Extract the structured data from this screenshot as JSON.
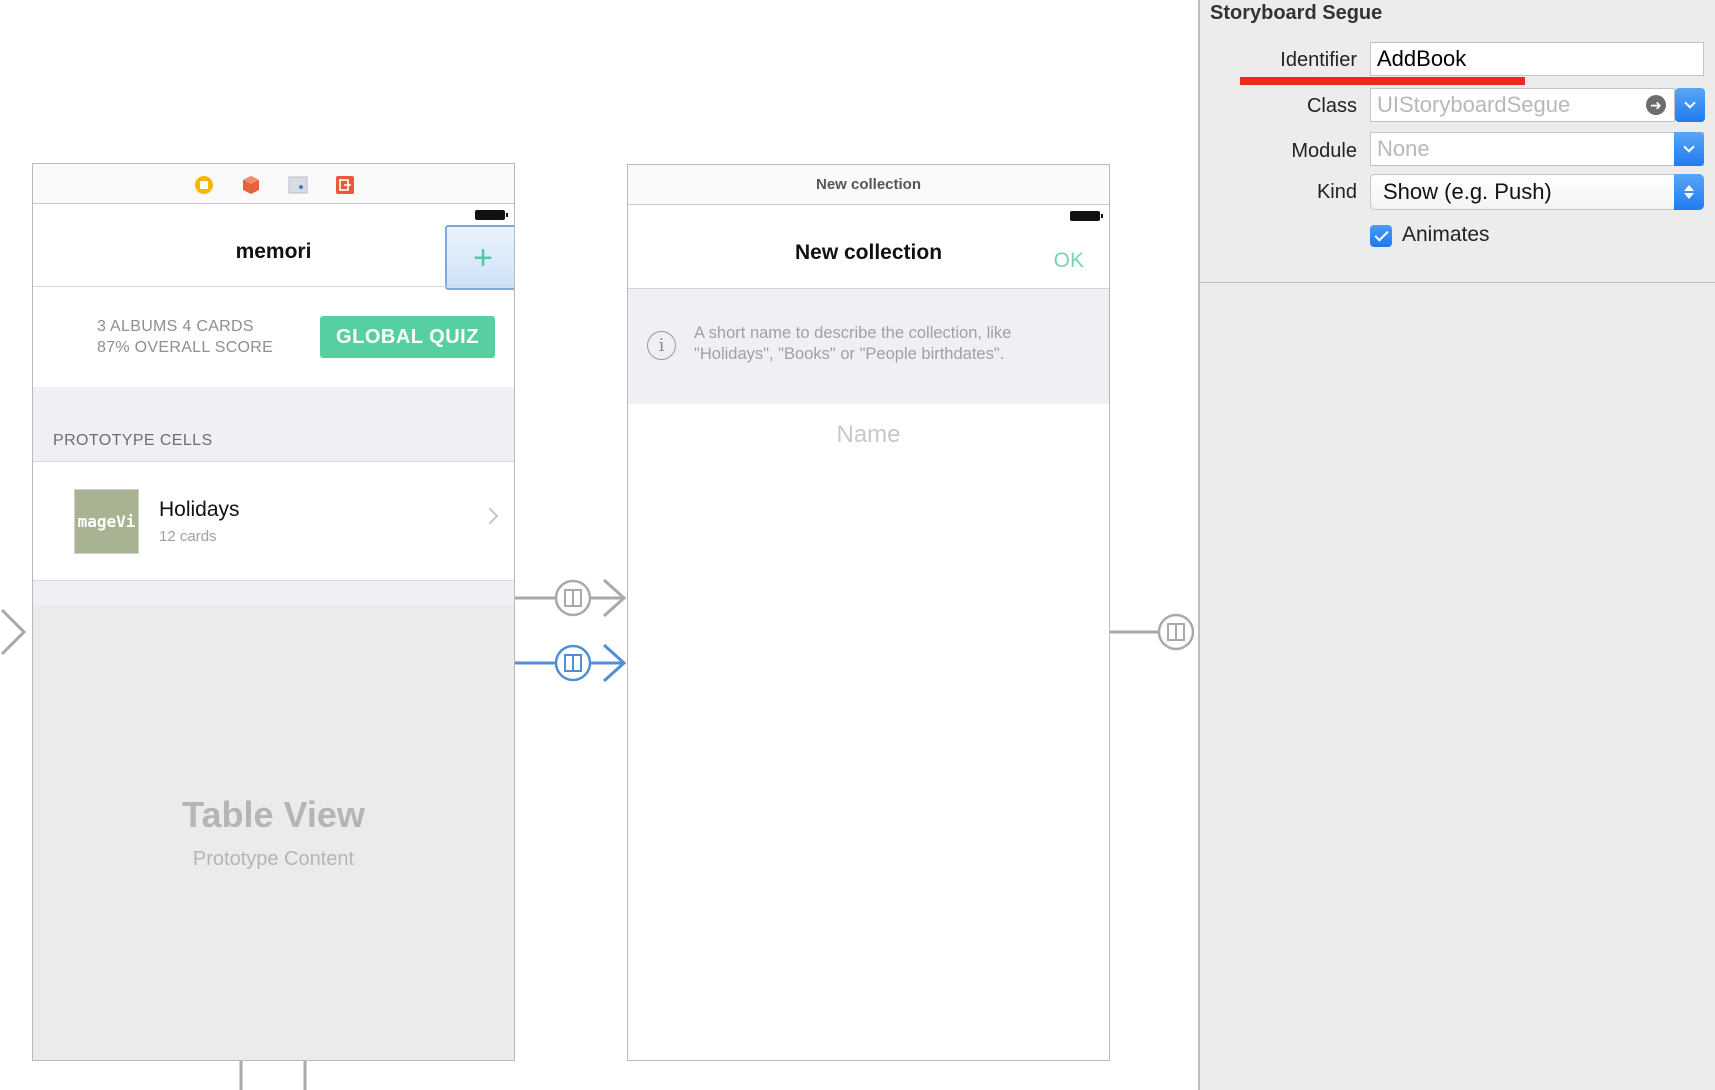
{
  "scene1": {
    "nav_title": "memori",
    "add_button": "+",
    "stats_line1": "3 ALBUMS 4 CARDS",
    "stats_line2": "87% OVERALL SCORE",
    "quiz_button": "GLOBAL QUIZ",
    "section_header": "PROTOTYPE CELLS",
    "cell": {
      "thumbnail_text": "mageVi",
      "title": "Holidays",
      "subtitle": "12 cards"
    },
    "table_view_title": "Table View",
    "table_view_subtitle": "Prototype Content",
    "dock_icons": [
      "view-controller-icon",
      "first-responder-icon",
      "storyboard-reference-icon",
      "exit-icon"
    ]
  },
  "scene2": {
    "scene_title": "New collection",
    "nav_title": "New collection",
    "ok_button": "OK",
    "info_text_line1": "A short name to describe the collection, like",
    "info_text_line2": "\"Holidays\", \"Books\" or \"People birthdates\".",
    "name_placeholder": "Name"
  },
  "inspector": {
    "section_title": "Storyboard Segue",
    "identifier_label": "Identifier",
    "identifier_value": "AddBook",
    "class_label": "Class",
    "class_value": "UIStoryboardSegue",
    "module_label": "Module",
    "module_value": "None",
    "kind_label": "Kind",
    "kind_value": "Show (e.g. Push)",
    "animates_label": "Animates",
    "animates_checked": true
  },
  "colors": {
    "accent_green": "#56cfa1",
    "selected_segue_blue": "#4f8fd6",
    "segue_gray": "#a9a9a9",
    "highlight_red": "#f0281e"
  }
}
